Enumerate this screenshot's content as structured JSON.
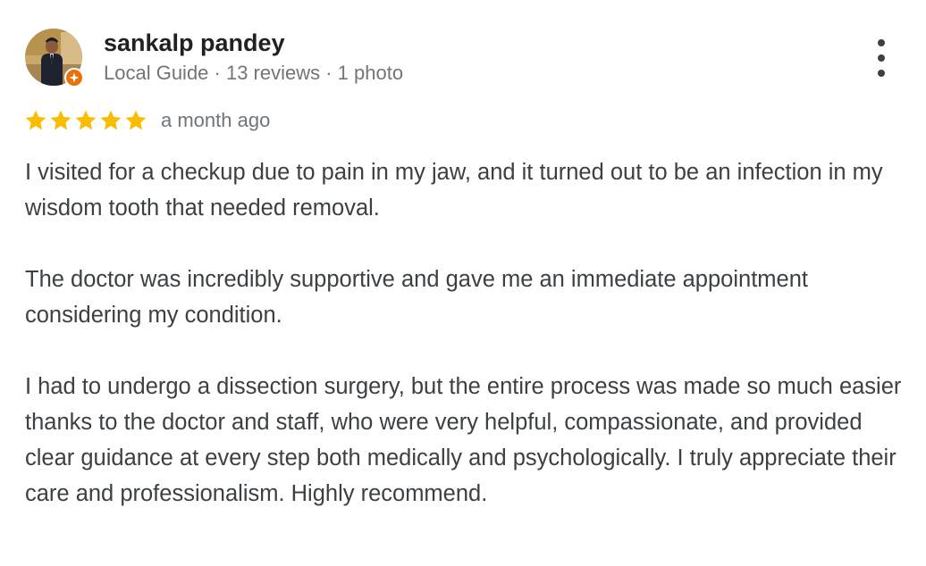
{
  "review": {
    "reviewer": {
      "name": "sankalp pandey",
      "meta": "Local Guide · 13 reviews · 1 photo",
      "avatar_icon": "user-photo",
      "badge_icon": "local-guide-star-icon",
      "badge_color": "#e8710a"
    },
    "rating": {
      "stars": 5,
      "max": 5,
      "star_color": "#fbbc04"
    },
    "date": "a month ago",
    "paragraphs": [
      "I visited for a checkup due to pain in my jaw, and it turned out to be an infection in my wisdom tooth that needed removal.",
      "The doctor was incredibly supportive and gave me an immediate appointment considering my condition.",
      "I had to undergo a dissection surgery, but the entire process was made so much easier thanks to the doctor and staff, who were very helpful, compassionate, and provided clear guidance at every step both medically and psychologically. I truly appreciate their care and professionalism. Highly recommend."
    ],
    "menu_icon": "more-vertical-icon"
  }
}
